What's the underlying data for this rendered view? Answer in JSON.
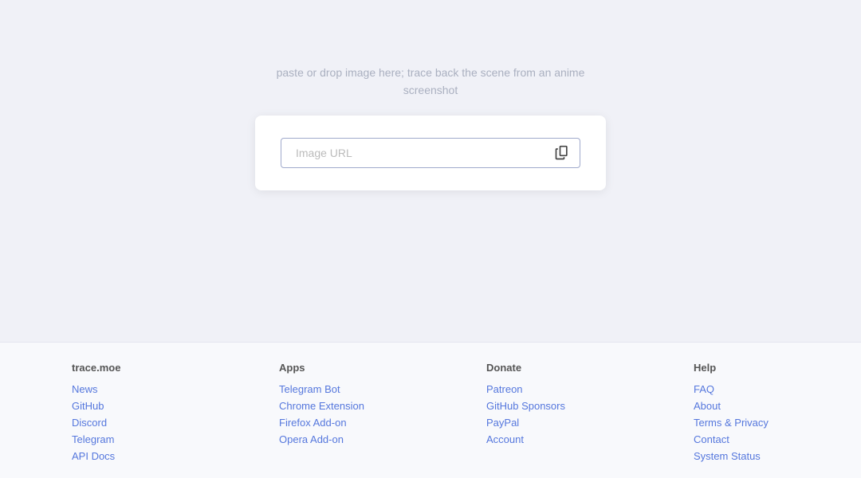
{
  "main": {
    "tagline_line1": "paste or drop image here; trace back the scene from an anime",
    "tagline_line2": "screenshot",
    "input_placeholder": "Image URL"
  },
  "footer": {
    "brand": {
      "name": "trace.moe"
    },
    "columns": [
      {
        "title": "trace.moe",
        "links": [
          {
            "label": "News",
            "href": "#"
          },
          {
            "label": "GitHub",
            "href": "#"
          },
          {
            "label": "Discord",
            "href": "#"
          },
          {
            "label": "Telegram",
            "href": "#"
          },
          {
            "label": "API Docs",
            "href": "#"
          }
        ]
      },
      {
        "title": "Apps",
        "links": [
          {
            "label": "Telegram Bot",
            "href": "#"
          },
          {
            "label": "Chrome Extension",
            "href": "#"
          },
          {
            "label": "Firefox Add-on",
            "href": "#"
          },
          {
            "label": "Opera Add-on",
            "href": "#"
          }
        ]
      },
      {
        "title": "Donate",
        "links": [
          {
            "label": "Patreon",
            "href": "#"
          },
          {
            "label": "GitHub Sponsors",
            "href": "#"
          },
          {
            "label": "PayPal",
            "href": "#"
          },
          {
            "label": "Account",
            "href": "#"
          }
        ]
      },
      {
        "title": "Help",
        "links": [
          {
            "label": "FAQ",
            "href": "#"
          },
          {
            "label": "About",
            "href": "#"
          },
          {
            "label": "Terms & Privacy",
            "href": "#"
          },
          {
            "label": "Contact",
            "href": "#"
          },
          {
            "label": "System Status",
            "href": "#"
          }
        ]
      }
    ]
  }
}
